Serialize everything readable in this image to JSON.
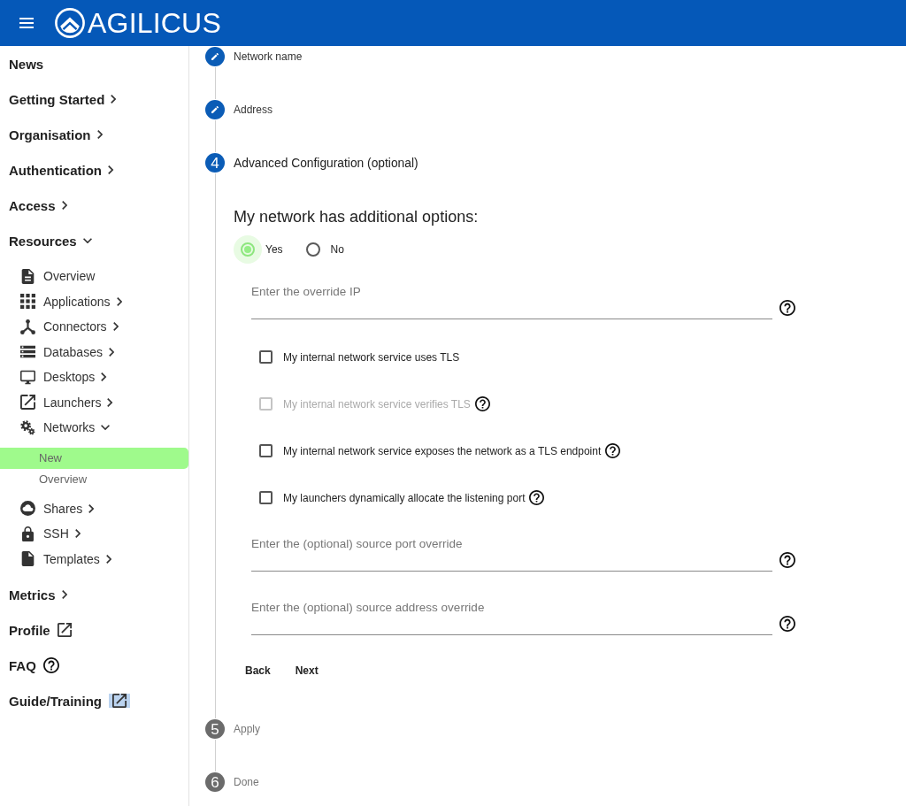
{
  "header": {
    "logo": "AGILICUS"
  },
  "sidebar": {
    "items": [
      {
        "label": "News",
        "kind": "link",
        "highlighted": false
      },
      {
        "label": "Getting Started",
        "kind": "menu",
        "expanded": false,
        "highlighted": false
      },
      {
        "label": "Organisation",
        "kind": "menu",
        "expanded": false,
        "highlighted": false
      },
      {
        "label": "Authentication",
        "kind": "menu",
        "expanded": false,
        "highlighted": false
      },
      {
        "label": "Access",
        "kind": "menu",
        "expanded": false,
        "highlighted": false
      },
      {
        "label": "Resources",
        "kind": "menu",
        "expanded": true,
        "highlighted": false,
        "children": [
          {
            "label": "Overview",
            "kind": "link"
          },
          {
            "label": "Applications",
            "kind": "menu",
            "expanded": false
          },
          {
            "label": "Connectors",
            "kind": "menu",
            "expanded": false
          },
          {
            "label": "Databases",
            "kind": "menu",
            "expanded": false
          },
          {
            "label": "Desktops",
            "kind": "menu",
            "expanded": false
          },
          {
            "label": "Launchers",
            "kind": "menu",
            "expanded": false
          },
          {
            "label": "Networks",
            "kind": "menu",
            "expanded": true,
            "children": [
              {
                "label": "New",
                "selected": true
              },
              {
                "label": "Overview",
                "selected": false
              }
            ]
          },
          {
            "label": "Shares",
            "kind": "menu",
            "expanded": false
          },
          {
            "label": "SSH",
            "kind": "menu",
            "expanded": false
          },
          {
            "label": "Templates",
            "kind": "menu",
            "expanded": false
          }
        ]
      },
      {
        "label": "Metrics",
        "kind": "menu",
        "expanded": false,
        "highlighted": false
      },
      {
        "label": "Profile",
        "kind": "external",
        "highlighted": false
      },
      {
        "label": "FAQ",
        "kind": "help",
        "highlighted": false
      },
      {
        "label": "Guide/Training",
        "kind": "external",
        "highlighted": true
      }
    ]
  },
  "stepper": {
    "steps": [
      {
        "kind": "edit",
        "label": "Network name"
      },
      {
        "kind": "edit",
        "label": "Address"
      },
      {
        "kind": "active",
        "number": "4",
        "label": "Advanced Configuration (optional)",
        "form": {
          "question": "My network has additional options:",
          "options": [
            {
              "label": "Yes",
              "selected": true
            },
            {
              "label": "No",
              "selected": false
            }
          ],
          "controls": [
            {
              "kind": "field",
              "placeholder": "Enter the override IP",
              "help": true
            },
            {
              "kind": "checkbox",
              "label": "My internal network service uses TLS",
              "checked": false,
              "disabled": false,
              "help": false
            },
            {
              "kind": "checkbox",
              "label": "My internal network service verifies TLS",
              "checked": false,
              "disabled": true,
              "help": true
            },
            {
              "kind": "checkbox",
              "label": "My internal network service exposes the network as a TLS endpoint",
              "checked": false,
              "disabled": false,
              "help": true
            },
            {
              "kind": "checkbox",
              "label": "My launchers dynamically allocate the listening port",
              "checked": false,
              "disabled": false,
              "help": true
            },
            {
              "kind": "field",
              "placeholder": "Enter the (optional) source port override",
              "help": true
            },
            {
              "kind": "field",
              "placeholder": "Enter the (optional) source address override",
              "help": true
            }
          ],
          "buttons": [
            "Back",
            "Next"
          ]
        }
      },
      {
        "kind": "pending",
        "number": "5",
        "label": "Apply"
      },
      {
        "kind": "pending",
        "number": "6",
        "label": "Done"
      }
    ]
  }
}
